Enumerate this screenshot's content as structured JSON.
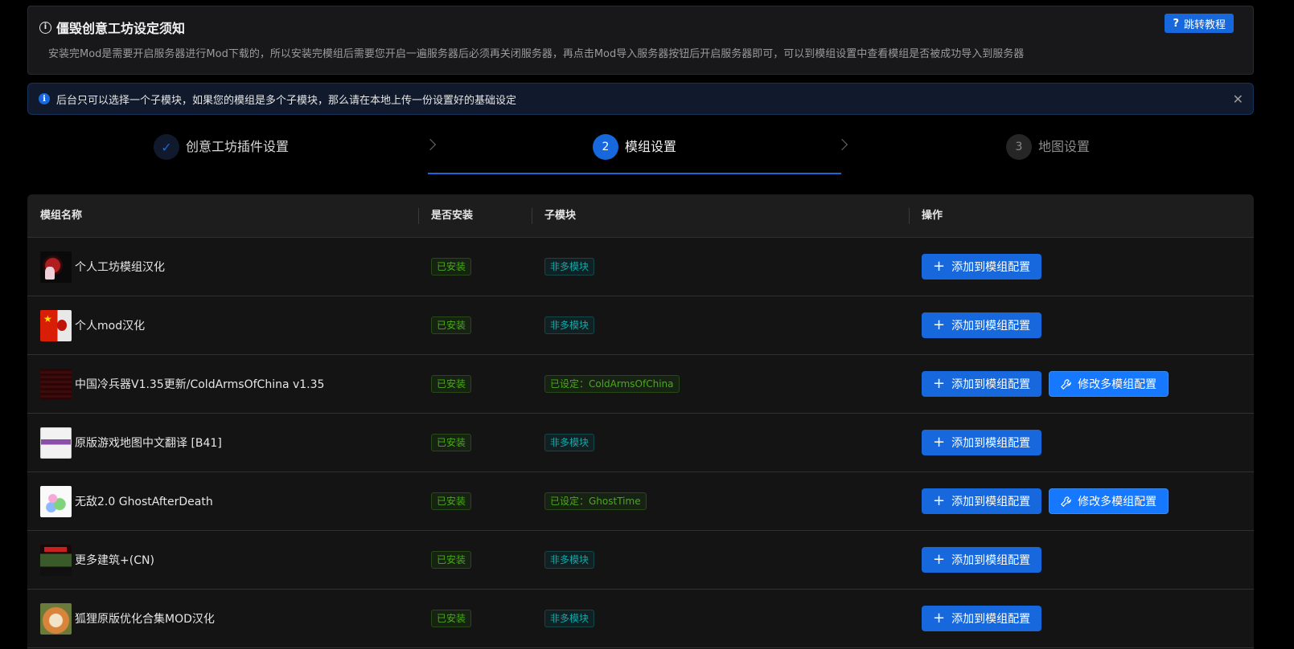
{
  "notice": {
    "title": "僵毁创意工坊设定须知",
    "description": "安装完Mod是需要开启服务器进行Mod下载的，所以安装完模组后需要您开启一遍服务器后必须再关闭服务器，再点击Mod导入服务器按钮后开启服务器即可，可以到模组设置中查看模组是否被成功导入到服务器",
    "tutorial_button": "跳转教程",
    "info_glyph": "i",
    "help_glyph": "?"
  },
  "alert": {
    "text": "后台只可以选择一个子模块，如果您的模组是多个子模块，那么请在本地上传一份设置好的基础设定",
    "icon_glyph": "i",
    "close_glyph": "✕"
  },
  "steps": [
    {
      "marker": "✓",
      "label": "创意工坊插件设置",
      "state": "finished"
    },
    {
      "marker": "2",
      "label": "模组设置",
      "state": "active"
    },
    {
      "marker": "3",
      "label": "地图设置",
      "state": "waiting"
    }
  ],
  "table": {
    "headers": {
      "name": "模组名称",
      "installed": "是否安装",
      "submodule": "子模块",
      "actions": "操作"
    },
    "rows": [
      {
        "name": "个人工坊模组汉化",
        "installed": "已安装",
        "submodule": "非多模块",
        "sub_type": "none",
        "add": "添加到模组配置",
        "edit": ""
      },
      {
        "name": "个人mod汉化",
        "installed": "已安装",
        "submodule": "非多模块",
        "sub_type": "none",
        "add": "添加到模组配置",
        "edit": ""
      },
      {
        "name": "中国冷兵器V1.35更新/ColdArmsOfChina v1.35",
        "installed": "已安装",
        "submodule": "已设定：ColdArmsOfChina",
        "sub_type": "set",
        "add": "添加到模组配置",
        "edit": "修改多模组配置"
      },
      {
        "name": "原版游戏地图中文翻译 [B41]",
        "installed": "已安装",
        "submodule": "非多模块",
        "sub_type": "none",
        "add": "添加到模组配置",
        "edit": ""
      },
      {
        "name": "无敌2.0 GhostAfterDeath",
        "installed": "已安装",
        "submodule": "已设定：GhostTime",
        "sub_type": "set",
        "add": "添加到模组配置",
        "edit": "修改多模组配置"
      },
      {
        "name": "更多建筑+(CN)",
        "installed": "已安装",
        "submodule": "非多模块",
        "sub_type": "none",
        "add": "添加到模组配置",
        "edit": ""
      },
      {
        "name": "狐狸原版优化合集MOD汉化",
        "installed": "已安装",
        "submodule": "非多模块",
        "sub_type": "none",
        "add": "添加到模组配置",
        "edit": ""
      }
    ]
  },
  "colors": {
    "primary": "#1668dc",
    "success": "#49aa19",
    "cyan": "#13a8a8",
    "background": "#000000",
    "card": "#141414"
  },
  "icons": {
    "plus": "plus-icon",
    "wrench": "wrench-icon",
    "check": "check-icon",
    "close": "close-icon",
    "info": "info-circle-icon",
    "help": "question-icon"
  }
}
